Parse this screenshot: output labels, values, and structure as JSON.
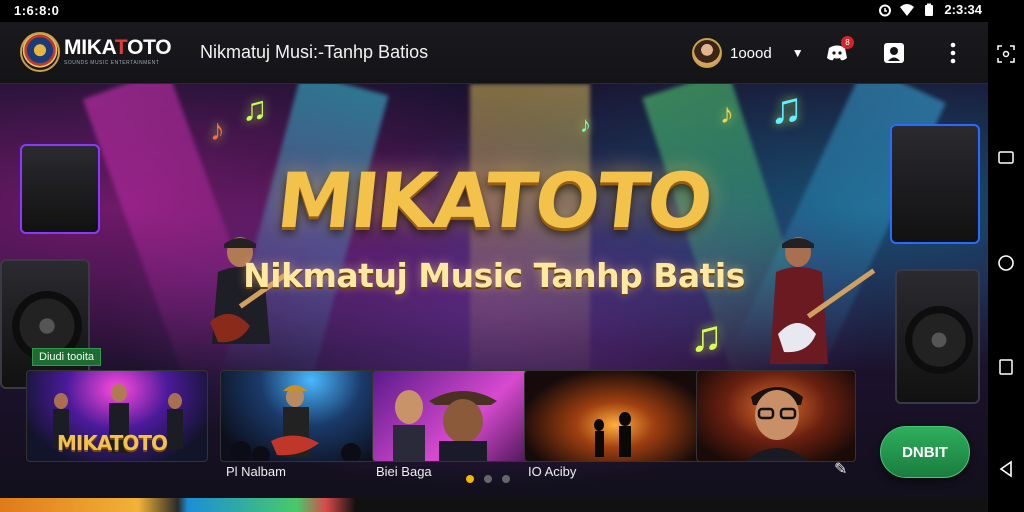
{
  "status_bar": {
    "time_left": "1:6:8:0",
    "time_right": "2:3:34"
  },
  "app_bar": {
    "logo_text_main": "MIKA",
    "logo_text_accent": "T",
    "logo_text_end": "OTO",
    "logo_subtitle": "SOUNDS MUSIC ENTERTAINMENT",
    "title": "Nikmatuj Musi:-Tanhp Batios",
    "user_name": "1oood",
    "notification_count": "8"
  },
  "hero": {
    "title": "MIKATOTO",
    "subtitle": "Nikmatuj Music Tanhp Batis",
    "section_label": "Diudi tooita",
    "cards": [
      {
        "caption": "",
        "logo": "MIKATOTO"
      },
      {
        "caption": "Pl Nalbam",
        "logo": ""
      },
      {
        "caption": "Biei Baga",
        "logo": ""
      },
      {
        "caption": "IO Aciby",
        "logo": ""
      },
      {
        "caption": "",
        "logo": ""
      }
    ],
    "cta_label": "DNBIT",
    "page_dots": 3,
    "active_dot": 0
  },
  "colors": {
    "accent_gold": "#f3c24a",
    "cta_green": "#2fae5d",
    "notification_red": "#d4242a",
    "logo_red": "#e23b3b"
  },
  "icons": {
    "status_left": [],
    "status_right": [
      "alarm-icon",
      "wifi-icon",
      "battery-icon"
    ],
    "app_bar": [
      "chevron-down-icon",
      "discord-icon",
      "game-face-icon",
      "more-vert-icon"
    ],
    "nav_bar": [
      "screenshot-icon",
      "rotate-icon",
      "home-icon",
      "recents-icon",
      "back-icon"
    ]
  }
}
